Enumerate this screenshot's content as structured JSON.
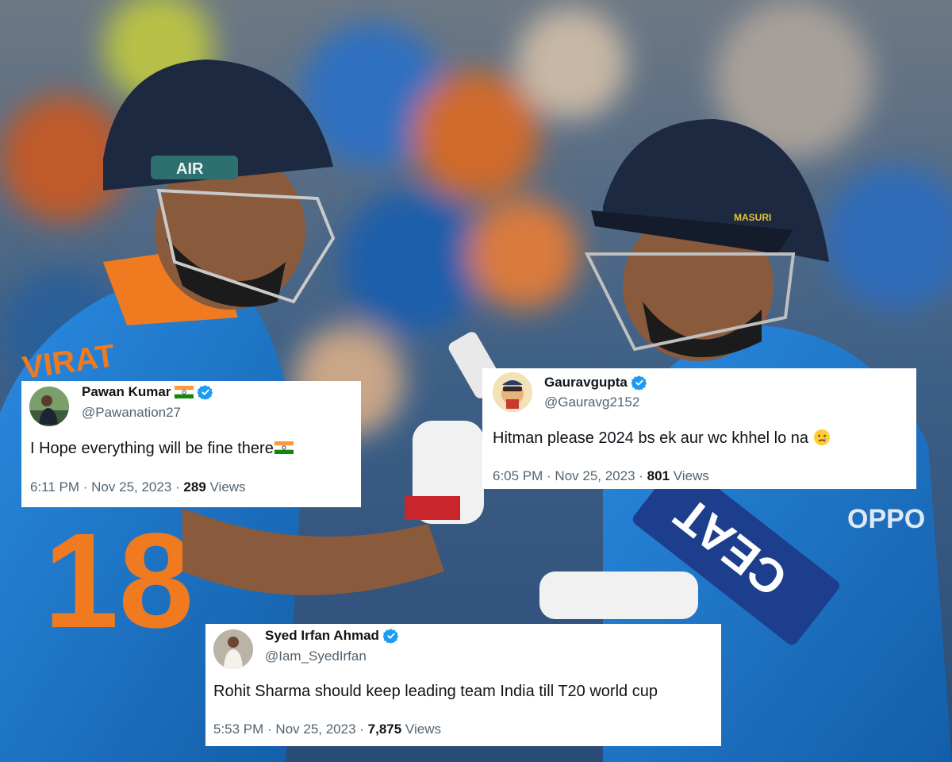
{
  "tweets": [
    {
      "name": "Pawan Kumar",
      "handle": "@Pawanation27",
      "text": "I Hope everything will be fine there",
      "time": "6:11 PM · Nov 25, 2023 · ",
      "views_count": "289",
      "views_label": " Views",
      "name_suffix_icon": "india-flag-icon",
      "text_suffix_icon": "india-flag-icon"
    },
    {
      "name": "Gauravgupta",
      "handle": "@Gauravg2152",
      "text": "Hitman please 2024 bs ek aur wc khhel lo na",
      "time": "6:05 PM · Nov 25, 2023 · ",
      "views_count": "801",
      "views_label": " Views",
      "text_suffix_icon": "crying-face-emoji"
    },
    {
      "name": "Syed Irfan Ahmad",
      "handle": "@Iam_SyedIrfan",
      "text": "Rohit Sharma should keep leading team India till T20 world cup",
      "time": "5:53 PM · Nov 25, 2023 · ",
      "views_count": "7,875",
      "views_label": " Views"
    }
  ],
  "background": {
    "jersey_text": "VIRAT",
    "jersey_number": "18",
    "helmet_badge": "AIR",
    "helmet_brand": "MASURI",
    "bat_brand": "CEAT",
    "shirt_sponsor": "OPPO"
  },
  "colors": {
    "verified": "#1d9bf0",
    "text_primary": "#0f1419",
    "text_secondary": "#536471",
    "jersey_blue": "#1f78c8"
  }
}
